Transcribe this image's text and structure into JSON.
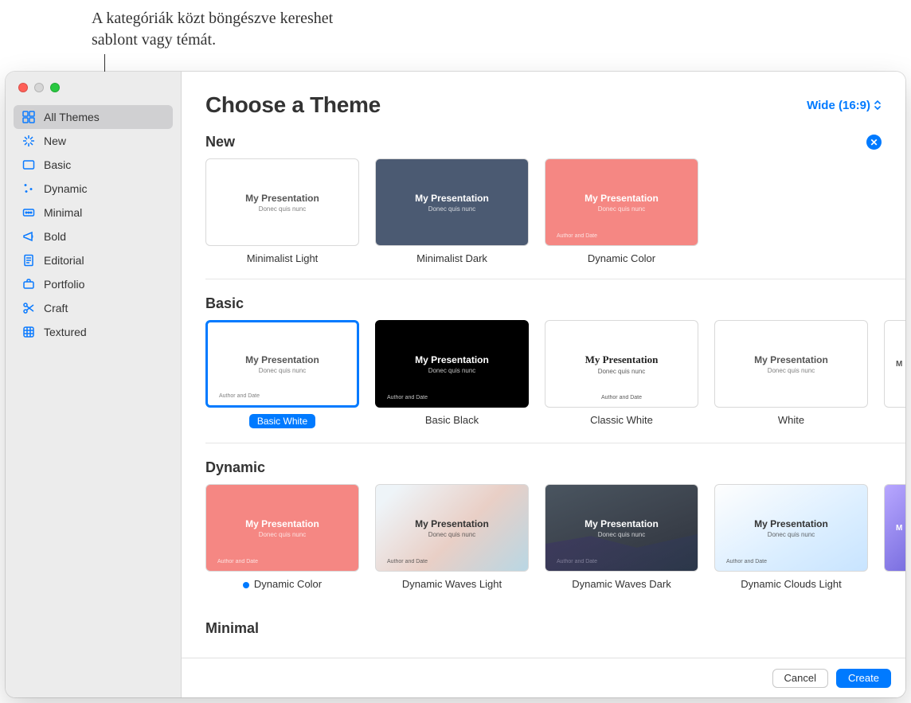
{
  "annotation": "A kategóriák közt böngészve kereshet sablont vagy témát.",
  "sidebar": {
    "items": [
      {
        "label": "All Themes",
        "active": true,
        "icon": "grid"
      },
      {
        "label": "New",
        "active": false,
        "icon": "sparkle"
      },
      {
        "label": "Basic",
        "active": false,
        "icon": "rectangle"
      },
      {
        "label": "Dynamic",
        "active": false,
        "icon": "stars"
      },
      {
        "label": "Minimal",
        "active": false,
        "icon": "dots"
      },
      {
        "label": "Bold",
        "active": false,
        "icon": "megaphone"
      },
      {
        "label": "Editorial",
        "active": false,
        "icon": "page"
      },
      {
        "label": "Portfolio",
        "active": false,
        "icon": "briefcase"
      },
      {
        "label": "Craft",
        "active": false,
        "icon": "scissors"
      },
      {
        "label": "Textured",
        "active": false,
        "icon": "texture"
      }
    ]
  },
  "header": {
    "title": "Choose a Theme",
    "aspect": "Wide (16:9)"
  },
  "thumb_text": {
    "title": "My Presentation",
    "subtitle": "Donec quis nunc",
    "footer": "Author and Date"
  },
  "sections": [
    {
      "title": "New",
      "closable": true,
      "themes": [
        {
          "label": "Minimalist Light",
          "bg": "bg-white",
          "selected": false,
          "dot": false,
          "centered": false,
          "showFooter": false,
          "showSub": true
        },
        {
          "label": "Minimalist Dark",
          "bg": "bg-dark",
          "selected": false,
          "dot": false,
          "centered": false,
          "showFooter": false,
          "showSub": true
        },
        {
          "label": "Dynamic Color",
          "bg": "bg-coral",
          "selected": false,
          "dot": false,
          "centered": false,
          "showFooter": true,
          "showSub": true
        }
      ]
    },
    {
      "title": "Basic",
      "closable": false,
      "themes": [
        {
          "label": "Basic White",
          "bg": "bg-white",
          "selected": true,
          "dot": false,
          "centered": false,
          "showFooter": true,
          "showSub": true
        },
        {
          "label": "Basic Black",
          "bg": "bg-black",
          "selected": false,
          "dot": false,
          "centered": false,
          "showFooter": true,
          "showSub": true
        },
        {
          "label": "Classic White",
          "bg": "bg-classic",
          "selected": false,
          "dot": false,
          "centered": true,
          "showFooter": true,
          "showSub": true
        },
        {
          "label": "White",
          "bg": "bg-white",
          "selected": false,
          "dot": false,
          "centered": true,
          "showFooter": false,
          "showSub": true
        }
      ],
      "overflow": "bg-white"
    },
    {
      "title": "Dynamic",
      "closable": false,
      "themes": [
        {
          "label": "Dynamic Color",
          "bg": "bg-coral",
          "selected": false,
          "dot": true,
          "centered": false,
          "showFooter": true,
          "showSub": true
        },
        {
          "label": "Dynamic Waves Light",
          "bg": "bg-waveslight",
          "selected": false,
          "dot": false,
          "centered": false,
          "showFooter": true,
          "showSub": true
        },
        {
          "label": "Dynamic Waves Dark",
          "bg": "bg-wavesdark",
          "selected": false,
          "dot": false,
          "centered": false,
          "showFooter": true,
          "showSub": true
        },
        {
          "label": "Dynamic Clouds Light",
          "bg": "bg-cloudslight",
          "selected": false,
          "dot": false,
          "centered": false,
          "showFooter": true,
          "showSub": true
        }
      ],
      "overflow": "bg-purple-snip"
    },
    {
      "title": "Minimal",
      "closable": false,
      "themes": []
    }
  ],
  "footer": {
    "cancel": "Cancel",
    "create": "Create"
  }
}
